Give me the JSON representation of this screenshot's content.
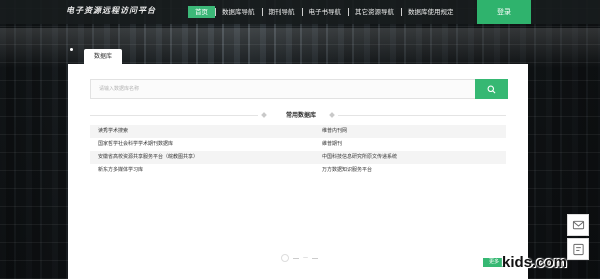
{
  "header": {
    "logo_text": "电子资源远程访问平台",
    "nav": [
      {
        "label": "首页",
        "active": true
      },
      {
        "label": "数据库导航",
        "active": false
      },
      {
        "label": "期刊导航",
        "active": false
      },
      {
        "label": "电子书导航",
        "active": false
      },
      {
        "label": "其它资源导航",
        "active": false
      },
      {
        "label": "数据库使用规定",
        "active": false
      }
    ],
    "login_label": "登录"
  },
  "panel": {
    "tab_label": "数据库",
    "search_placeholder": "请输入数据库名称",
    "section_title": "常用数据库",
    "databases": [
      [
        "读秀学术搜索",
        "维普内刊网"
      ],
      [
        "国家哲学社会科学学术期刊数据库",
        "維普期刊"
      ],
      [
        "安徽省高校资源共享服务平台（皖教图共享）",
        "中国科技信息研究所原文传递系统"
      ],
      [
        "新东方多媒体学习库",
        "万方数据知识服务平台"
      ]
    ],
    "pager_text": "一",
    "more_label": "更多"
  },
  "watermark": "kids.com",
  "colors": {
    "accent": "#36b873",
    "header_bg": "#181c1e",
    "panel_bg": "#ffffff"
  },
  "icons": {
    "search": "search-icon",
    "message": "message-icon",
    "feedback": "feedback-icon"
  }
}
